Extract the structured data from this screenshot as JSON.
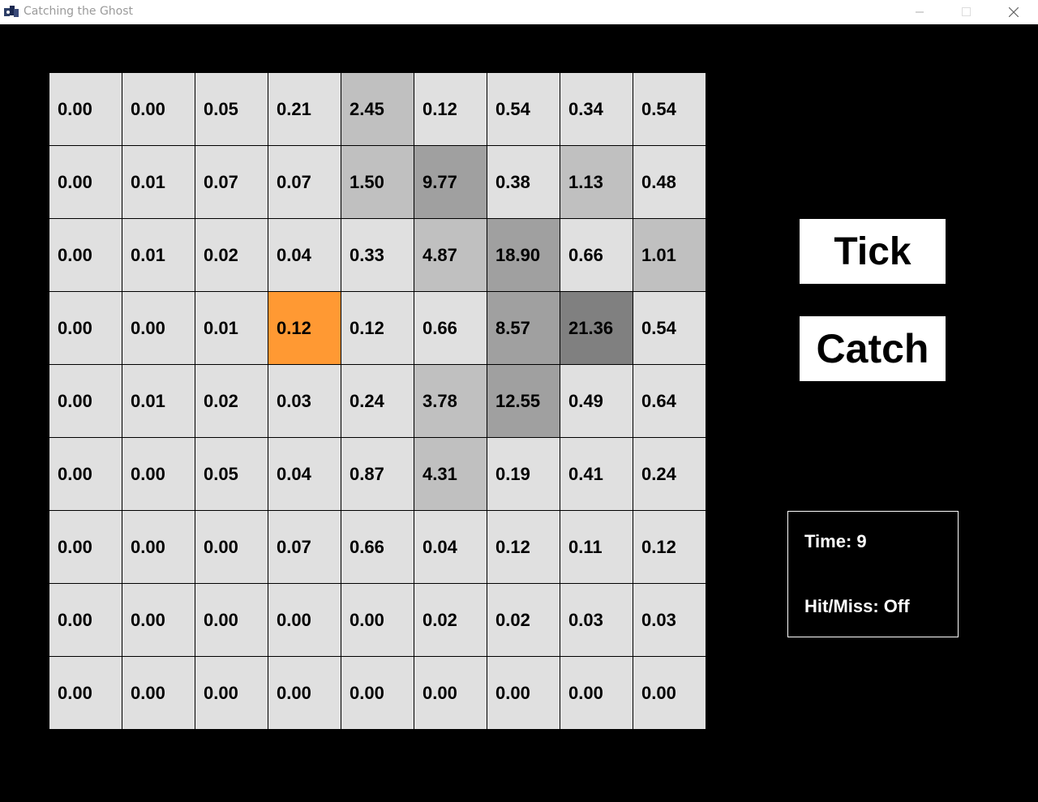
{
  "window": {
    "title": "Catching the Ghost"
  },
  "grid": {
    "rows": [
      [
        "0.00",
        "0.00",
        "0.05",
        "0.21",
        "2.45",
        "0.12",
        "0.54",
        "0.34",
        "0.54"
      ],
      [
        "0.00",
        "0.01",
        "0.07",
        "0.07",
        "1.50",
        "9.77",
        "0.38",
        "1.13",
        "0.48"
      ],
      [
        "0.00",
        "0.01",
        "0.02",
        "0.04",
        "0.33",
        "4.87",
        "18.90",
        "0.66",
        "1.01"
      ],
      [
        "0.00",
        "0.00",
        "0.01",
        "0.12",
        "0.12",
        "0.66",
        "8.57",
        "21.36",
        "0.54"
      ],
      [
        "0.00",
        "0.01",
        "0.02",
        "0.03",
        "0.24",
        "3.78",
        "12.55",
        "0.49",
        "0.64"
      ],
      [
        "0.00",
        "0.00",
        "0.05",
        "0.04",
        "0.87",
        "4.31",
        "0.19",
        "0.41",
        "0.24"
      ],
      [
        "0.00",
        "0.00",
        "0.00",
        "0.07",
        "0.66",
        "0.04",
        "0.12",
        "0.11",
        "0.12"
      ],
      [
        "0.00",
        "0.00",
        "0.00",
        "0.00",
        "0.00",
        "0.02",
        "0.02",
        "0.03",
        "0.03"
      ],
      [
        "0.00",
        "0.00",
        "0.00",
        "0.00",
        "0.00",
        "0.00",
        "0.00",
        "0.00",
        "0.00"
      ]
    ],
    "shades": [
      [
        "#e0e0e0",
        "#e0e0e0",
        "#e0e0e0",
        "#e0e0e0",
        "#c0c0c0",
        "#e0e0e0",
        "#e0e0e0",
        "#e0e0e0",
        "#e0e0e0"
      ],
      [
        "#e0e0e0",
        "#e0e0e0",
        "#e0e0e0",
        "#e0e0e0",
        "#c0c0c0",
        "#a0a0a0",
        "#e0e0e0",
        "#c0c0c0",
        "#e0e0e0"
      ],
      [
        "#e0e0e0",
        "#e0e0e0",
        "#e0e0e0",
        "#e0e0e0",
        "#e0e0e0",
        "#c0c0c0",
        "#a0a0a0",
        "#e0e0e0",
        "#c0c0c0"
      ],
      [
        "#e0e0e0",
        "#e0e0e0",
        "#e0e0e0",
        "#ff9933",
        "#e0e0e0",
        "#e0e0e0",
        "#a0a0a0",
        "#808080",
        "#e0e0e0"
      ],
      [
        "#e0e0e0",
        "#e0e0e0",
        "#e0e0e0",
        "#e0e0e0",
        "#e0e0e0",
        "#c0c0c0",
        "#a0a0a0",
        "#e0e0e0",
        "#e0e0e0"
      ],
      [
        "#e0e0e0",
        "#e0e0e0",
        "#e0e0e0",
        "#e0e0e0",
        "#e0e0e0",
        "#c0c0c0",
        "#e0e0e0",
        "#e0e0e0",
        "#e0e0e0"
      ],
      [
        "#e0e0e0",
        "#e0e0e0",
        "#e0e0e0",
        "#e0e0e0",
        "#e0e0e0",
        "#e0e0e0",
        "#e0e0e0",
        "#e0e0e0",
        "#e0e0e0"
      ],
      [
        "#e0e0e0",
        "#e0e0e0",
        "#e0e0e0",
        "#e0e0e0",
        "#e0e0e0",
        "#e0e0e0",
        "#e0e0e0",
        "#e0e0e0",
        "#e0e0e0"
      ],
      [
        "#e0e0e0",
        "#e0e0e0",
        "#e0e0e0",
        "#e0e0e0",
        "#e0e0e0",
        "#e0e0e0",
        "#e0e0e0",
        "#e0e0e0",
        "#e0e0e0"
      ]
    ]
  },
  "buttons": {
    "tick": "Tick",
    "catch": "Catch"
  },
  "status": {
    "time": "Time: 9",
    "hit_miss": "Hit/Miss: Off"
  },
  "colors": {
    "background": "#000000",
    "player_cell": "#ff9933",
    "base_cell": "#e0e0e0"
  },
  "icons": {
    "app": "app-icon",
    "minimize": "minimize-icon",
    "maximize": "maximize-icon",
    "close": "close-icon"
  }
}
